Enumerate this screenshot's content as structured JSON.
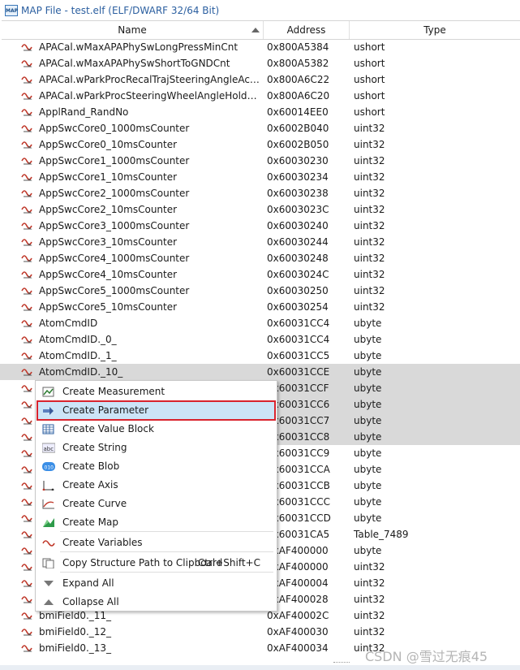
{
  "window": {
    "title": "MAP File - test.elf (ELF/DWARF 32/64 Bit)",
    "app_icon_text": "MAP"
  },
  "columns": {
    "name": "Name",
    "address": "Address",
    "type": "Type"
  },
  "rows": [
    {
      "name": "APACal.wMaxAPAPhySwLongPressMinCnt",
      "address": "0x800A5384",
      "type": "ushort"
    },
    {
      "name": "APACal.wMaxAPAPhySwShortToGNDCnt",
      "address": "0x800A5382",
      "type": "ushort"
    },
    {
      "name": "APACal.wParkProcRecalTrajSteeringAngleAch...",
      "address": "0x800A6C22",
      "type": "ushort"
    },
    {
      "name": "APACal.wParkProcSteeringWheelAngleHoldTi...",
      "address": "0x800A6C20",
      "type": "ushort"
    },
    {
      "name": "ApplRand_RandNo",
      "address": "0x60014EE0",
      "type": "ushort"
    },
    {
      "name": "AppSwcCore0_1000msCounter",
      "address": "0x6002B040",
      "type": "uint32"
    },
    {
      "name": "AppSwcCore0_10msCounter",
      "address": "0x6002B050",
      "type": "uint32"
    },
    {
      "name": "AppSwcCore1_1000msCounter",
      "address": "0x60030230",
      "type": "uint32"
    },
    {
      "name": "AppSwcCore1_10msCounter",
      "address": "0x60030234",
      "type": "uint32"
    },
    {
      "name": "AppSwcCore2_1000msCounter",
      "address": "0x60030238",
      "type": "uint32"
    },
    {
      "name": "AppSwcCore2_10msCounter",
      "address": "0x6003023C",
      "type": "uint32"
    },
    {
      "name": "AppSwcCore3_1000msCounter",
      "address": "0x60030240",
      "type": "uint32"
    },
    {
      "name": "AppSwcCore3_10msCounter",
      "address": "0x60030244",
      "type": "uint32"
    },
    {
      "name": "AppSwcCore4_1000msCounter",
      "address": "0x60030248",
      "type": "uint32"
    },
    {
      "name": "AppSwcCore4_10msCounter",
      "address": "0x6003024C",
      "type": "uint32"
    },
    {
      "name": "AppSwcCore5_1000msCounter",
      "address": "0x60030250",
      "type": "uint32"
    },
    {
      "name": "AppSwcCore5_10msCounter",
      "address": "0x60030254",
      "type": "uint32"
    },
    {
      "name": "AtomCmdID",
      "address": "0x60031CC4",
      "type": "ubyte"
    },
    {
      "name": "AtomCmdID._0_",
      "address": "0x60031CC4",
      "type": "ubyte"
    },
    {
      "name": "AtomCmdID._1_",
      "address": "0x60031CC5",
      "type": "ubyte"
    },
    {
      "name": "AtomCmdID._10_",
      "address": "0x60031CCE",
      "type": "ubyte"
    },
    {
      "name": "",
      "address": "0x60031CCF",
      "type": "ubyte"
    },
    {
      "name": "",
      "address": "0x60031CC6",
      "type": "ubyte"
    },
    {
      "name": "",
      "address": "0x60031CC7",
      "type": "ubyte"
    },
    {
      "name": "",
      "address": "0x60031CC8",
      "type": "ubyte"
    },
    {
      "name": "",
      "address": "0x60031CC9",
      "type": "ubyte"
    },
    {
      "name": "",
      "address": "0x60031CCA",
      "type": "ubyte"
    },
    {
      "name": "",
      "address": "0x60031CCB",
      "type": "ubyte"
    },
    {
      "name": "",
      "address": "0x60031CCC",
      "type": "ubyte"
    },
    {
      "name": "",
      "address": "0x60031CCD",
      "type": "ubyte"
    },
    {
      "name": "",
      "address": "0x60031CA5",
      "type": "Table_7489"
    },
    {
      "name": "",
      "address": "0xAF400000",
      "type": "ubyte"
    },
    {
      "name": "",
      "address": "0xAF400000",
      "type": "uint32"
    },
    {
      "name": "",
      "address": "0xAF400004",
      "type": "uint32"
    },
    {
      "name": "",
      "address": "0xAF400028",
      "type": "uint32"
    },
    {
      "name": "bmiField0._11_",
      "address": "0xAF40002C",
      "type": "uint32"
    },
    {
      "name": "bmiField0._12_",
      "address": "0xAF400030",
      "type": "uint32"
    },
    {
      "name": "bmiField0._13_",
      "address": "0xAF400034",
      "type": "uint32"
    }
  ],
  "context_menu": {
    "items": [
      {
        "label": "Create Measurement",
        "icon": "measurement-icon"
      },
      {
        "label": "Create Parameter",
        "icon": "parameter-icon"
      },
      {
        "label": "Create Value Block",
        "icon": "value-block-icon"
      },
      {
        "label": "Create String",
        "icon": "string-icon"
      },
      {
        "label": "Create Blob",
        "icon": "blob-icon"
      },
      {
        "label": "Create Axis",
        "icon": "axis-icon"
      },
      {
        "label": "Create Curve",
        "icon": "curve-icon"
      },
      {
        "label": "Create Map",
        "icon": "map-icon"
      },
      {
        "label": "Create Variables",
        "icon": "variables-icon"
      },
      {
        "label": "Copy Structure Path to Clipboard",
        "shortcut": "Ctrl+Shift+C",
        "icon": "copy-icon"
      },
      {
        "label": "Expand All",
        "icon": "expand-all-icon"
      },
      {
        "label": "Collapse All",
        "icon": "collapse-all-icon"
      }
    ],
    "highlighted": "Create Parameter"
  },
  "watermark": "CSDN @雪过无痕45",
  "colors": {
    "selection_bg": "#d9d9d9",
    "menu_highlight": "#cce4f7",
    "annotation_box": "#d9232d",
    "title_text": "#2b5fa0"
  }
}
